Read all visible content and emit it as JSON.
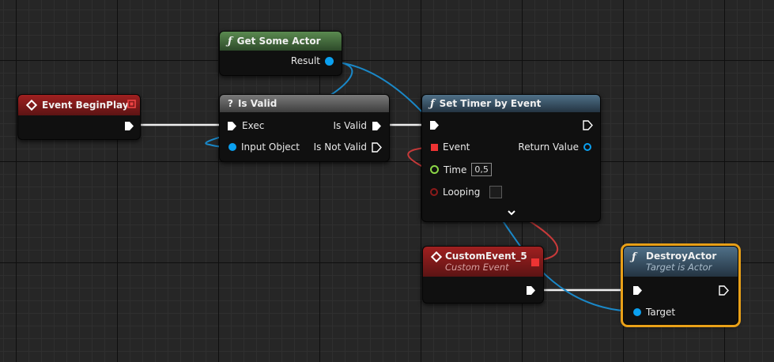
{
  "colors": {
    "exec": "#ffffff",
    "object": "#0aa0f0",
    "float": "#8cd646",
    "bool": "#8c1a1a",
    "delegate": "#ee3333",
    "event_header": "#8a1a1a",
    "function_header": "#3e5c72",
    "pure_header": "#4c6f44",
    "macro_header": "#6a6a6a",
    "selection": "#e8a018"
  },
  "nodes": {
    "event_begin_play": {
      "title": "Event BeginPlay",
      "icon": "event-diamond-icon"
    },
    "get_some_actor": {
      "title": "Get Some Actor",
      "icon": "function-icon",
      "pins": {
        "result": "Result"
      }
    },
    "is_valid": {
      "title": "Is Valid",
      "icon": "question-icon",
      "pins": {
        "exec": "Exec",
        "input_object": "Input Object",
        "is_valid": "Is Valid",
        "is_not_valid": "Is Not Valid"
      }
    },
    "set_timer": {
      "title": "Set Timer by Event",
      "icon": "function-icon",
      "pins": {
        "event": "Event",
        "return_value": "Return Value",
        "time": "Time",
        "time_value": "0,5",
        "looping": "Looping",
        "looping_checked": false
      }
    },
    "custom_event": {
      "title": "CustomEvent_5",
      "subtitle": "Custom Event",
      "icon": "event-diamond-icon"
    },
    "destroy_actor": {
      "title": "DestroyActor",
      "subtitle": "Target is Actor",
      "icon": "function-icon",
      "selected": true,
      "pins": {
        "target": "Target"
      }
    }
  }
}
